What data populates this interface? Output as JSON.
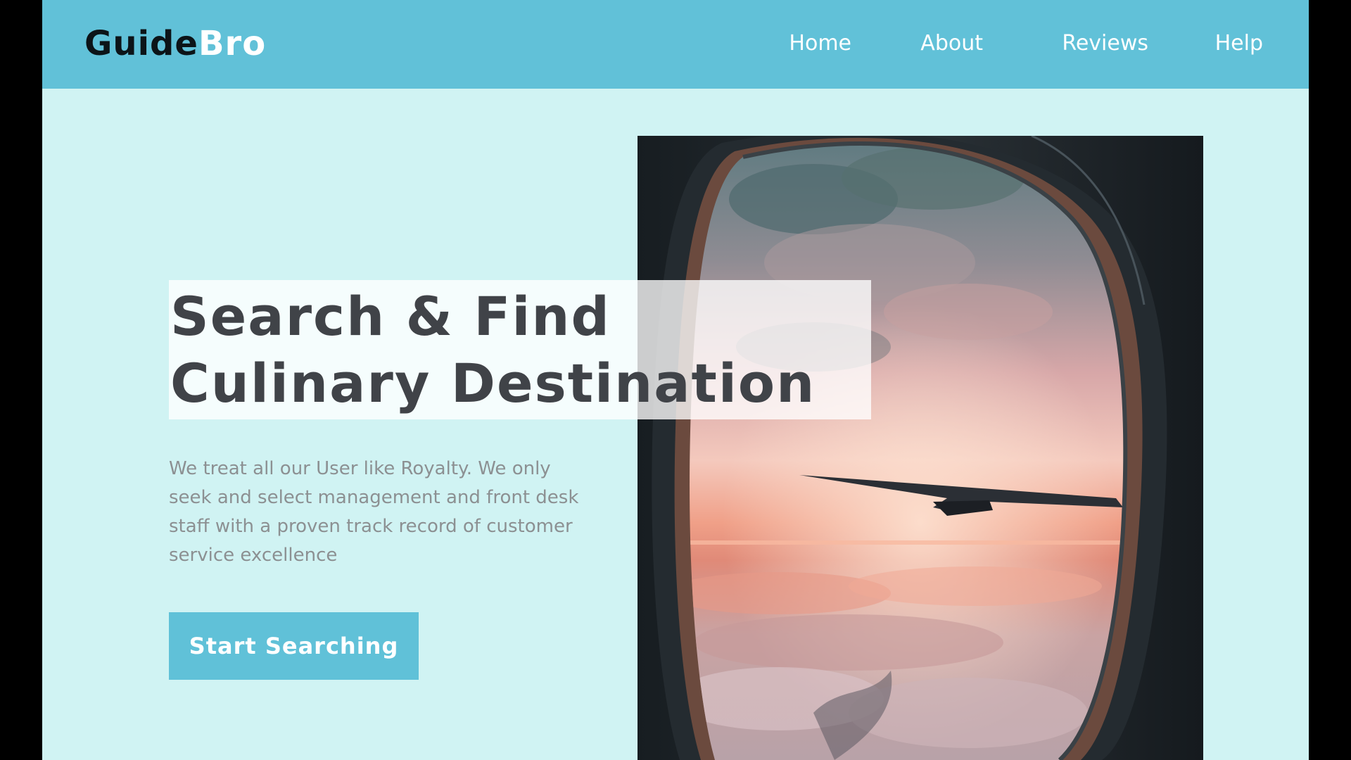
{
  "brand": {
    "logo_part_a": "Guide",
    "logo_part_b": "Bro"
  },
  "nav": {
    "items": [
      {
        "label": "Home"
      },
      {
        "label": "About"
      },
      {
        "label": "Reviews"
      },
      {
        "label": "Help"
      }
    ]
  },
  "hero": {
    "title_line_1": "Search & Find",
    "title_line_2": "Culinary Destination",
    "description": "We treat all our User like Royalty.  We only seek and select management and front desk staff with a proven track record of customer service excellence",
    "cta_label": "Start Searching",
    "image_subject": "airplane-window-sunset-clouds"
  },
  "colors": {
    "navbar": "#61c1d8",
    "page_background": "#d0f3f3",
    "button": "#60c1d8",
    "title_text": "#404348",
    "body_text": "#8c9092",
    "logo_dark": "#0c1418",
    "letterbox": "#000000"
  }
}
